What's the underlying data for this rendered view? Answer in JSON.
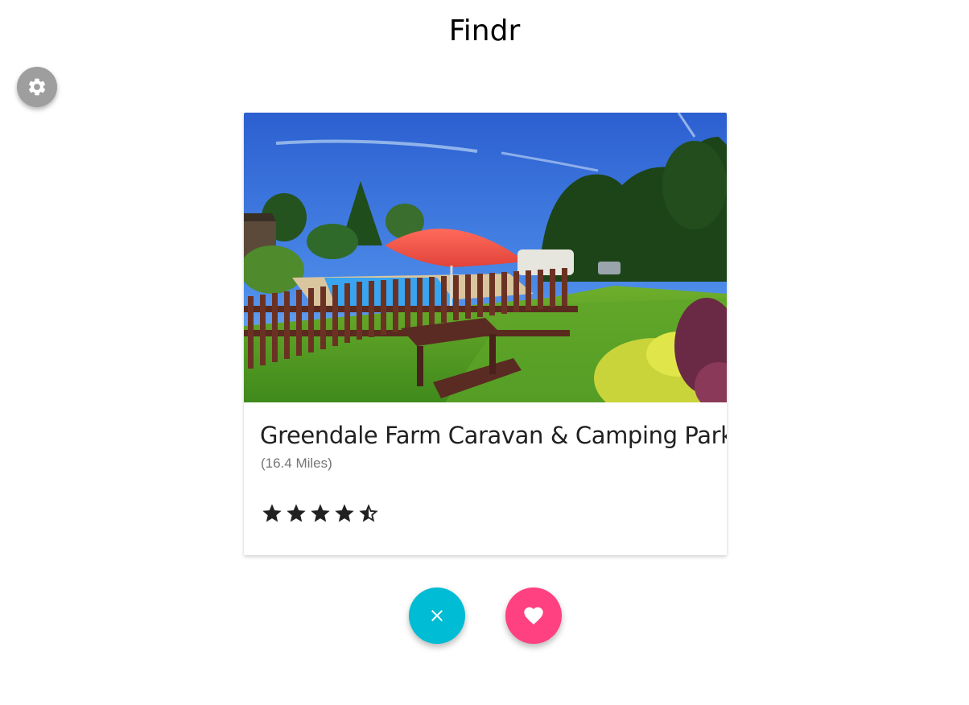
{
  "app": {
    "title": "Findr"
  },
  "settings": {
    "icon": "gear-icon",
    "color": "#9e9e9e"
  },
  "card": {
    "name": "Greendale Farm Caravan & Camping Park",
    "distance": "(16.4 Miles)",
    "rating": 4.5,
    "rating_max": 5,
    "photo_description_icon": "campsite-photo"
  },
  "actions": {
    "dismiss": {
      "icon": "close-icon",
      "color": "#00bcd4"
    },
    "like": {
      "icon": "heart-icon",
      "color": "#ff4081"
    }
  }
}
